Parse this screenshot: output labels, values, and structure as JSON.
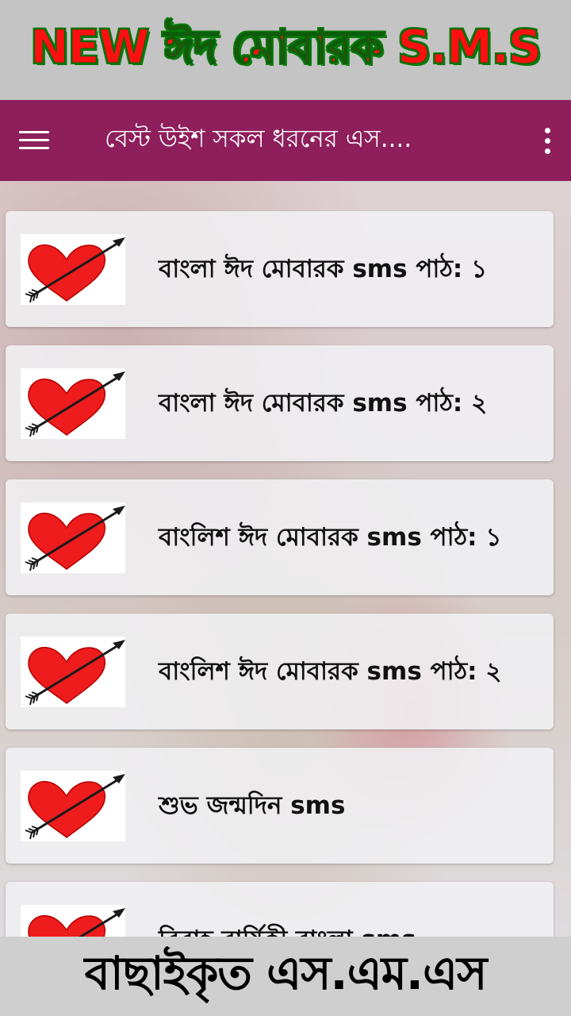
{
  "promo_top": {
    "text": "NEW ঈদ মোবারক S.M.S"
  },
  "appbar": {
    "menu_icon": "hamburger-menu-icon",
    "title": "বেস্ট উইশ সকল ধরনের এস....",
    "overflow_icon": "more-vert-icon",
    "background_color": "#8e1f5c"
  },
  "list": {
    "thumbnail_icon": "heart-arrow-icon",
    "items": [
      {
        "label": "বাংলা ঈদ মোবারক sms পাঠ: ১"
      },
      {
        "label": "বাংলা ঈদ মোবারক sms পাঠ: ২"
      },
      {
        "label": "বাংলিশ ঈদ মোবারক sms পাঠ: ১"
      },
      {
        "label": "বাংলিশ ঈদ মোবারক sms পাঠ: ২"
      },
      {
        "label": "শুভ জন্মদিন sms"
      },
      {
        "label": "বিবাহ বার্ষিকী বাংলা sms"
      }
    ]
  },
  "promo_bottom": {
    "text": "বাছাইকৃত এস.এম.এস"
  }
}
